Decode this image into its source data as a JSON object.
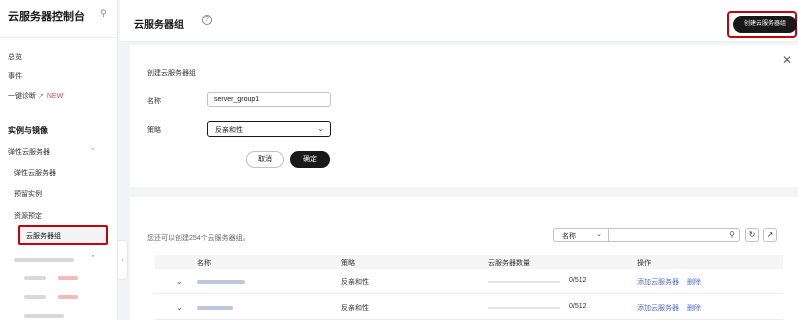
{
  "sidebar": {
    "title": "云服务器控制台",
    "items": {
      "overview": "总览",
      "events": "事件",
      "diagnose": "一键诊断",
      "new_badge": "NEW",
      "group_instances": "实例与镜像",
      "ecs": "弹性云服务器",
      "ecs_sub": "弹性云服务器",
      "reserved": "预留实例",
      "resource_reservation": "资源预定",
      "server_groups": "云服务器组"
    }
  },
  "header": {
    "title": "云服务器组",
    "create_button": "创建云服务器组"
  },
  "form": {
    "heading": "创建云服务器组",
    "name_label": "名称",
    "name_value": "server_group1",
    "policy_label": "策略",
    "policy_value": "反亲和性",
    "cancel": "取消",
    "confirm": "确定"
  },
  "list": {
    "quota_text": "您还可以创建254个云服务器组。",
    "filter_field": "名称",
    "columns": [
      "名称",
      "策略",
      "云服务器数量",
      "操作"
    ],
    "rows": [
      {
        "policy": "反亲和性",
        "count": "0/512",
        "action_add": "添加云服务器",
        "action_delete": "删除"
      },
      {
        "policy": "反亲和性",
        "count": "0/512",
        "action_add": "添加云服务器",
        "action_delete": "删除"
      }
    ]
  },
  "colors": {
    "highlight_border": "#c7000b",
    "primary_button": "#191919",
    "link": "#526ecc",
    "new_badge": "#e54545"
  }
}
